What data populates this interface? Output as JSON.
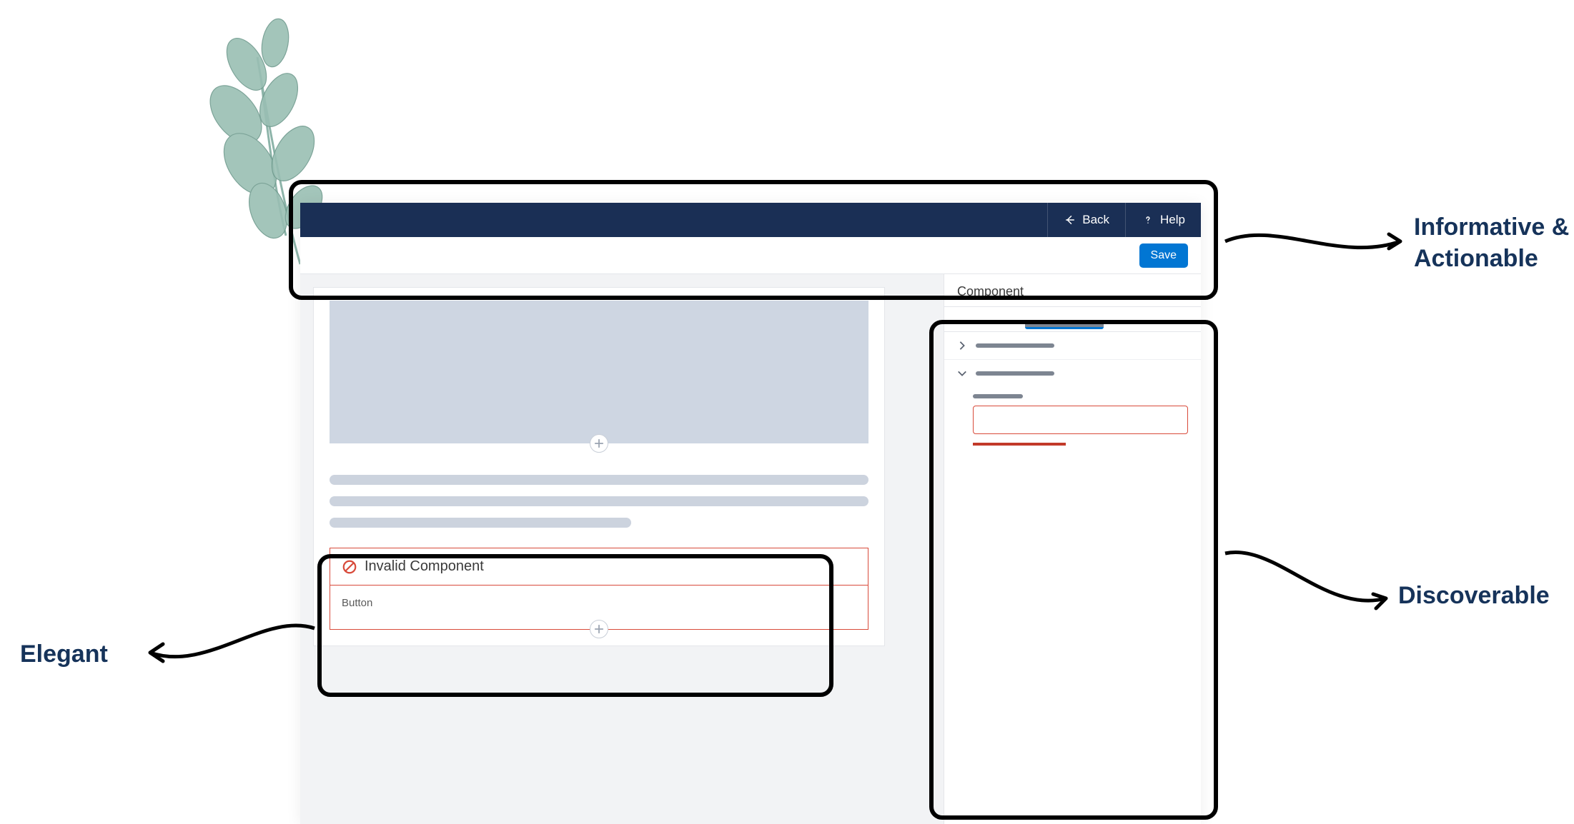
{
  "annotations": {
    "informative": "Informative & Actionable",
    "discoverable": "Discoverable",
    "elegant": "Elegant"
  },
  "topbar": {
    "back_label": "Back",
    "help_label": "Help"
  },
  "subbar": {
    "save_label": "Save"
  },
  "canvas": {
    "invalid_title": "Invalid Component",
    "invalid_body": "Button"
  },
  "panel": {
    "title": "Component"
  }
}
